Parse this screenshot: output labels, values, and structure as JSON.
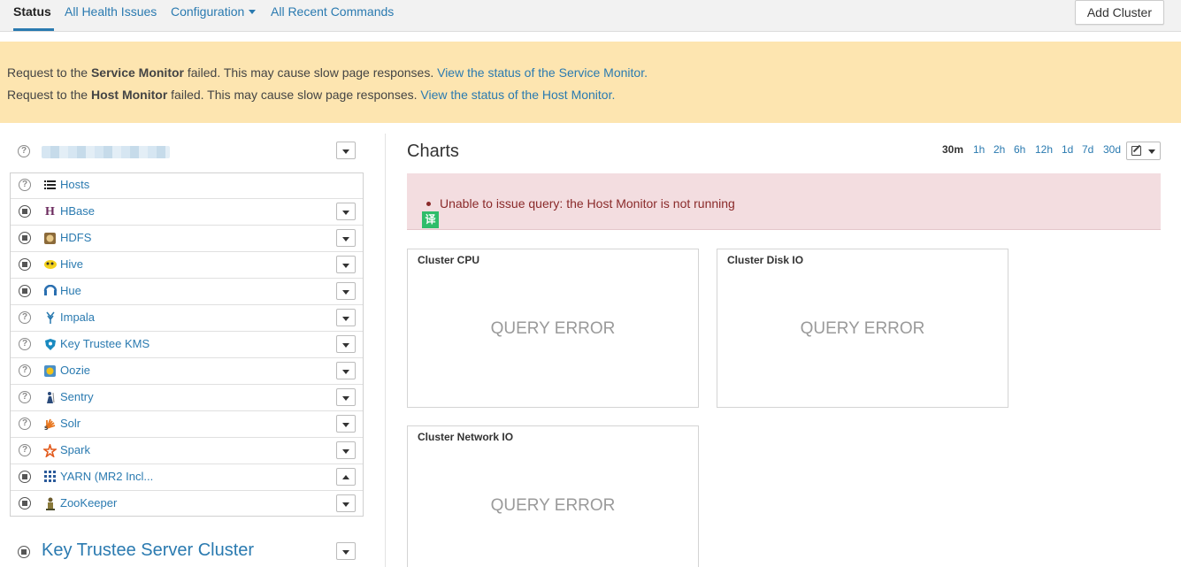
{
  "nav": {
    "tabs": [
      "Status",
      "All Health Issues",
      "Configuration",
      "All Recent Commands"
    ],
    "add_cluster": "Add Cluster"
  },
  "banner": {
    "line1": {
      "prefix": "Request to the ",
      "bold": "Service Monitor",
      "suffix": " failed. This may cause slow page responses. ",
      "link": "View the status of the Service Monitor."
    },
    "line2": {
      "prefix": "Request to the ",
      "bold": "Host Monitor",
      "suffix": " failed. This may cause slow page responses. ",
      "link": "View the status of the Host Monitor."
    },
    "background": "#fde5b0"
  },
  "sidebar": {
    "services": [
      {
        "name": "Hosts",
        "status": "unknown",
        "icon": "hosts-list-icon"
      },
      {
        "name": "HBase",
        "status": "stopped",
        "icon": "hbase-icon"
      },
      {
        "name": "HDFS",
        "status": "stopped",
        "icon": "hdfs-icon"
      },
      {
        "name": "Hive",
        "status": "stopped",
        "icon": "hive-icon"
      },
      {
        "name": "Hue",
        "status": "stopped",
        "icon": "hue-icon"
      },
      {
        "name": "Impala",
        "status": "unknown",
        "icon": "impala-icon"
      },
      {
        "name": "Key Trustee KMS",
        "status": "unknown",
        "icon": "key-trustee-icon"
      },
      {
        "name": "Oozie",
        "status": "unknown",
        "icon": "oozie-icon"
      },
      {
        "name": "Sentry",
        "status": "unknown",
        "icon": "sentry-icon"
      },
      {
        "name": "Solr",
        "status": "unknown",
        "icon": "solr-icon"
      },
      {
        "name": "Spark",
        "status": "unknown",
        "icon": "spark-icon"
      },
      {
        "name": "YARN (MR2 Incl...",
        "status": "stopped",
        "icon": "yarn-icon"
      },
      {
        "name": "ZooKeeper",
        "status": "stopped",
        "icon": "zookeeper-icon"
      }
    ],
    "second_cluster": "Key Trustee Server Cluster"
  },
  "charts": {
    "title": "Charts",
    "time_ranges": [
      "30m",
      "1h",
      "2h",
      "6h",
      "12h",
      "1d",
      "7d",
      "30d"
    ],
    "active_range": "30m",
    "error_message": "Unable to issue query: the Host Monitor is not running",
    "translate_badge": "译",
    "cards": [
      {
        "title": "Cluster CPU",
        "status": "QUERY ERROR"
      },
      {
        "title": "Cluster Disk IO",
        "status": "QUERY ERROR"
      },
      {
        "title": "Cluster Network IO",
        "status": "QUERY ERROR"
      }
    ]
  }
}
